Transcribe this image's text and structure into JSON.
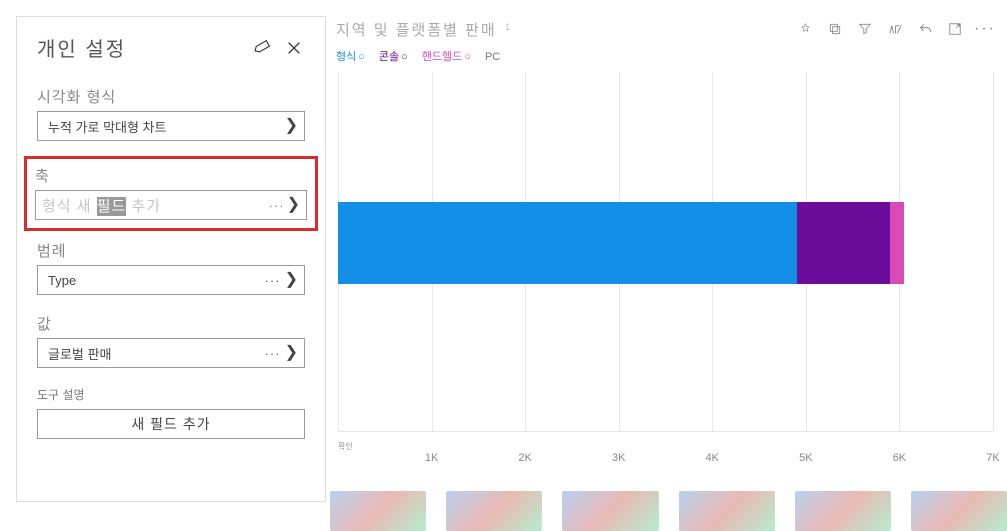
{
  "panel": {
    "title": "개인 설정",
    "viz_label": "시각화 형식",
    "viz_value": "누적 가로 막대형 차트",
    "axis_label": "축",
    "axis_value_prefix": "형식 새 ",
    "axis_value_selected": "필드",
    "axis_value_suffix": " 추가",
    "legend_label": "범례",
    "legend_value": "Type",
    "values_label": "값",
    "values_value": "글로벌 판매",
    "tooltip_label": "도구 설명",
    "add_field": "새 필드 추가"
  },
  "chart": {
    "title": "지역 및 플랫폼별 판매",
    "title_sup": "1",
    "legend": [
      {
        "label": "형식",
        "color": "c-blue"
      },
      {
        "label": "콘솔",
        "color": "c-purple"
      },
      {
        "label": "핸드헬드",
        "color": "c-magenta"
      },
      {
        "label": "PC",
        "color": "c-gray"
      }
    ],
    "axis_suffix": "K",
    "axis_small_label": "확인"
  },
  "chart_data": {
    "type": "bar",
    "orientation": "horizontal",
    "stacked": true,
    "xlabel": "",
    "ylabel": "",
    "xlim": [
      0,
      7
    ],
    "xunit": "K",
    "xticks": [
      1,
      2,
      3,
      4,
      5,
      6,
      7
    ],
    "xtick_labels": [
      "1K",
      "2K",
      "3K",
      "4K",
      "5K",
      "6K",
      "7K"
    ],
    "categories": [
      ""
    ],
    "series": [
      {
        "name": "형식",
        "color": "#148fe8",
        "values": [
          4.9
        ]
      },
      {
        "name": "콘솔",
        "color": "#6b0c9a",
        "values": [
          1.0
        ]
      },
      {
        "name": "핸드헬드",
        "color": "#d84bb5",
        "values": [
          0.15
        ]
      },
      {
        "name": "PC",
        "color": "#777777",
        "values": [
          0
        ]
      }
    ]
  }
}
